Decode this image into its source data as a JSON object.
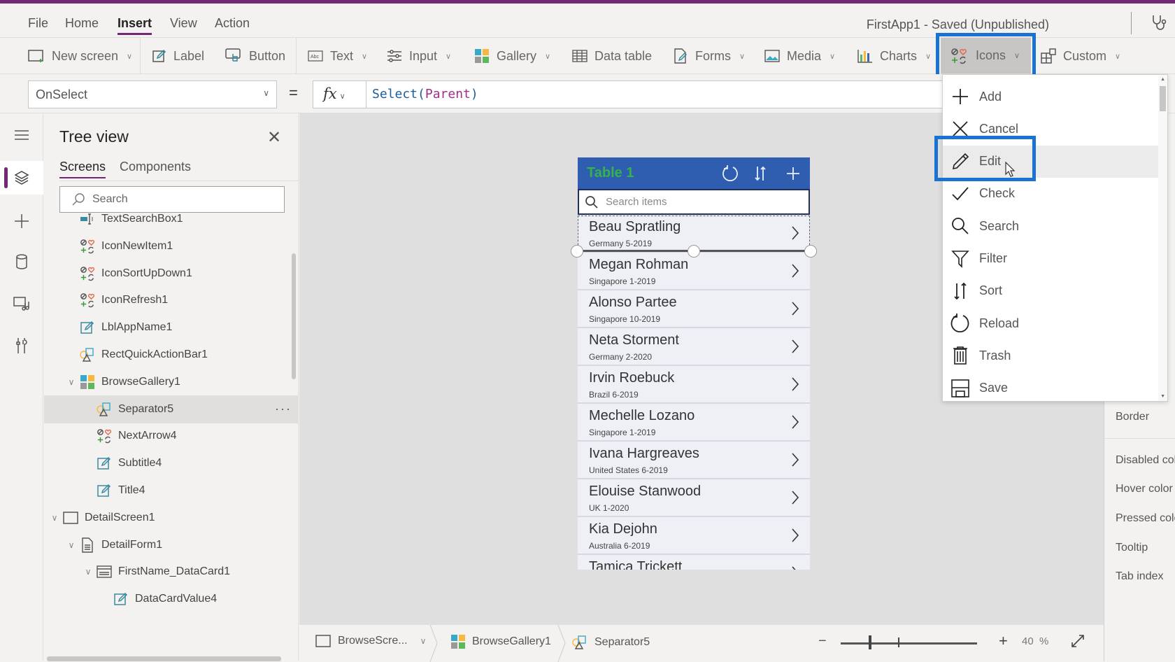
{
  "menubar": {
    "items": [
      "File",
      "Home",
      "Insert",
      "View",
      "Action"
    ],
    "active": "Insert",
    "app_status": "FirstApp1 - Saved (Unpublished)"
  },
  "ribbon": {
    "new_screen": "New screen",
    "label": "Label",
    "button": "Button",
    "text": "Text",
    "input": "Input",
    "gallery": "Gallery",
    "data_table": "Data table",
    "forms": "Forms",
    "media": "Media",
    "charts": "Charts",
    "icons": "Icons",
    "custom": "Custom"
  },
  "formula_bar": {
    "property": "OnSelect",
    "equals": "=",
    "fx": "fx",
    "func": "Select(",
    "arg": "Parent",
    "close": ")"
  },
  "tree_view": {
    "title": "Tree view",
    "tabs": [
      "Screens",
      "Components"
    ],
    "active_tab": "Screens",
    "search_placeholder": "Search",
    "items": [
      {
        "label": "TextSearchBox1",
        "icon": "text-input-icon",
        "level": 1
      },
      {
        "label": "IconNewItem1",
        "icon": "icons-control-icon",
        "level": 1
      },
      {
        "label": "IconSortUpDown1",
        "icon": "icons-control-icon",
        "level": 1
      },
      {
        "label": "IconRefresh1",
        "icon": "icons-control-icon",
        "level": 1
      },
      {
        "label": "LblAppName1",
        "icon": "label-icon",
        "level": 1
      },
      {
        "label": "RectQuickActionBar1",
        "icon": "shape-icon",
        "level": 1
      },
      {
        "label": "BrowseGallery1",
        "icon": "gallery-icon",
        "level": 1,
        "expanded": true
      },
      {
        "label": "Separator5",
        "icon": "shape-icon",
        "level": 2,
        "selected": true
      },
      {
        "label": "NextArrow4",
        "icon": "icons-control-icon",
        "level": 2
      },
      {
        "label": "Subtitle4",
        "icon": "label-icon",
        "level": 2
      },
      {
        "label": "Title4",
        "icon": "label-icon",
        "level": 2
      },
      {
        "label": "DetailScreen1",
        "icon": "screen-icon",
        "level": 0,
        "expanded": true
      },
      {
        "label": "DetailForm1",
        "icon": "form-icon",
        "level": 1,
        "expanded": true
      },
      {
        "label": "FirstName_DataCard1",
        "icon": "datacard-icon",
        "level": 2,
        "expanded": true
      },
      {
        "label": "DataCardValue4",
        "icon": "label-icon",
        "level": 3
      }
    ]
  },
  "app_preview": {
    "title": "Table 1",
    "search_placeholder": "Search items",
    "rows": [
      {
        "name": "Beau Spratling",
        "sub": "Germany 5-2019"
      },
      {
        "name": "Megan Rohman",
        "sub": "Singapore 1-2019"
      },
      {
        "name": "Alonso Partee",
        "sub": "Singapore 10-2019"
      },
      {
        "name": "Neta Storment",
        "sub": "Germany 2-2020"
      },
      {
        "name": "Irvin Roebuck",
        "sub": "Brazil 6-2019"
      },
      {
        "name": "Mechelle Lozano",
        "sub": "Singapore 1-2019"
      },
      {
        "name": "Ivana Hargreaves",
        "sub": "United States 6-2019"
      },
      {
        "name": "Elouise Stanwood",
        "sub": "UK 1-2020"
      },
      {
        "name": "Kia Dejohn",
        "sub": "Australia 6-2019"
      },
      {
        "name": "Tamica Trickett",
        "sub": ""
      }
    ]
  },
  "icons_menu": {
    "items": [
      "Add",
      "Cancel",
      "Edit",
      "Check",
      "Search",
      "Filter",
      "Sort",
      "Reload",
      "Trash",
      "Save"
    ],
    "hovered": "Edit"
  },
  "right_panel": {
    "labels": [
      "Border",
      "Disabled color",
      "Hover color",
      "Pressed color",
      "Tooltip",
      "Tab index"
    ]
  },
  "bottom_bar": {
    "breadcrumb": [
      "BrowseScre...",
      "BrowseGallery1",
      "Separator5"
    ],
    "zoom_value": "40",
    "zoom_unit": "%",
    "zoom_minus": "−",
    "zoom_plus": "+"
  },
  "colors": {
    "accent": "#742774",
    "highlight": "#1a73d1",
    "app_header": "#2f5db0",
    "app_title": "#33b24d"
  }
}
